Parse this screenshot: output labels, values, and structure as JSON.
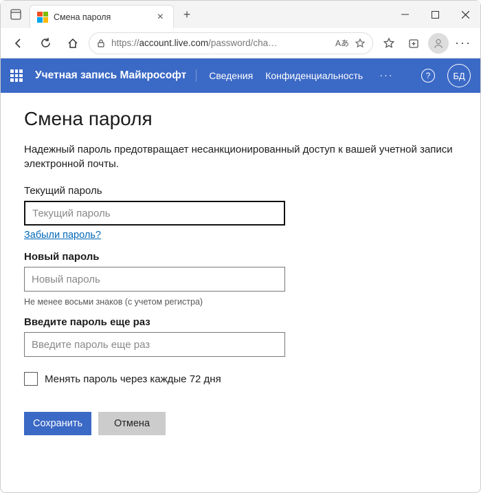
{
  "window": {
    "tab_title": "Смена пароля",
    "new_tab_label": "+"
  },
  "toolbar": {
    "url_prefix": "https://",
    "url_host": "account.live.com",
    "url_path": "/password/cha…",
    "reader_label": "Aあ"
  },
  "blue_header": {
    "brand": "Учетная запись Майкрософт",
    "nav_info": "Сведения",
    "nav_privacy": "Конфиденциальность",
    "nav_more": "···",
    "help": "?",
    "user_initials": "БД"
  },
  "page": {
    "title": "Смена пароля",
    "description": "Надежный пароль предотвращает несанкционированный доступ к вашей учетной записи электронной почты.",
    "current_label": "Текущий пароль",
    "current_placeholder": "Текущий пароль",
    "forgot": "Забыли пароль?",
    "new_label": "Новый пароль",
    "new_placeholder": "Новый пароль",
    "hint": "Не менее восьми знаков (с учетом регистра)",
    "confirm_label": "Введите пароль еще раз",
    "confirm_placeholder": "Введите пароль еще раз",
    "checkbox_label": "Менять пароль через каждые 72 дня",
    "save": "Сохранить",
    "cancel": "Отмена"
  }
}
